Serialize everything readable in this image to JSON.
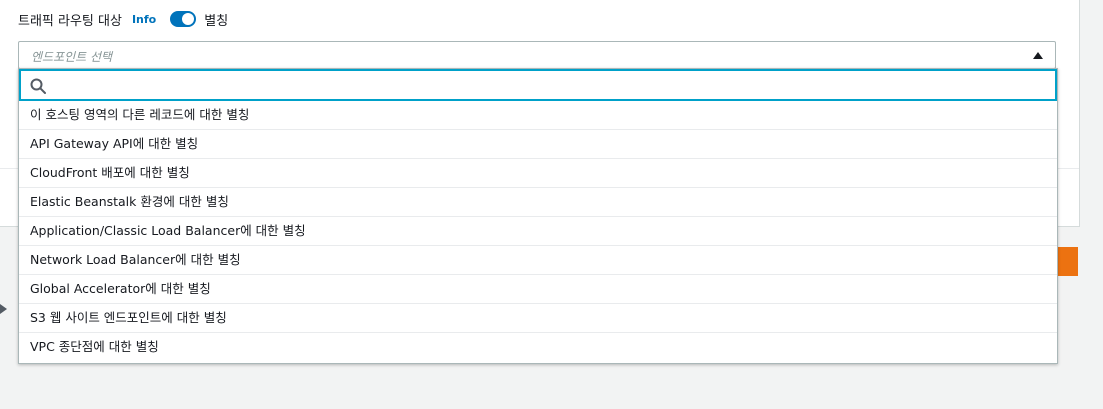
{
  "routing": {
    "label": "트래픽 라우팅 대상",
    "info_link": "Info",
    "alias_label": "별칭"
  },
  "select": {
    "placeholder": "엔드포인트 선택"
  },
  "search": {
    "value": "",
    "placeholder": ""
  },
  "options": [
    {
      "label": "이 호스팅 영역의 다른 레코드에 대한 별칭"
    },
    {
      "label": "API Gateway API에 대한 별칭"
    },
    {
      "label": "CloudFront 배포에 대한 별칭"
    },
    {
      "label": "Elastic Beanstalk 환경에 대한 별칭"
    },
    {
      "label": "Application/Classic Load Balancer에 대한 별칭"
    },
    {
      "label": "Network Load Balancer에 대한 별칭"
    },
    {
      "label": "Global Accelerator에 대한 별칭"
    },
    {
      "label": "S3 웹 사이트 엔드포인트에 대한 별칭"
    },
    {
      "label": "VPC 종단점에 대한 별칭"
    }
  ],
  "icons": {
    "search": "search-icon",
    "caret": "caret-up-icon",
    "expand": "caret-right-icon"
  },
  "colors": {
    "accent": "#0073bb",
    "focus_border": "#00a1c9",
    "primary_button": "#ec7211",
    "background": "#f2f3f3"
  },
  "toggle": {
    "checked": true
  }
}
